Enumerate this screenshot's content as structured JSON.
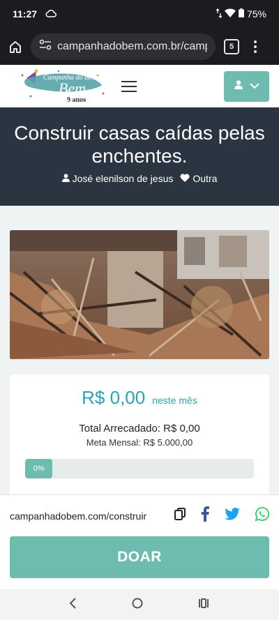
{
  "status_bar": {
    "time": "11:27",
    "battery": "75%"
  },
  "browser": {
    "url": "campanhadobem.com.br/campanh",
    "tab_count": "5"
  },
  "site": {
    "logo_text": "Campanha do Bem",
    "logo_sub": "9 anos"
  },
  "campaign": {
    "title": "Construir casas caídas pelas enchentes.",
    "author": "José elenilson de jesus",
    "category": "Outra",
    "amount": "R$ 0,00",
    "amount_period": "neste mês",
    "total_raised": "Total Arrecadado: R$ 0,00",
    "monthly_goal": "Meta Mensal: R$ 5.000,00",
    "progress_label": "0%",
    "progress_value": 0
  },
  "share": {
    "url": "campanhadobem.com/construir"
  },
  "donate": {
    "label": "DOAR"
  },
  "colors": {
    "accent": "#6dbcaf",
    "amount": "#28a4b6",
    "hero_bg": "#2b3541",
    "facebook": "#3b5998",
    "twitter": "#1da1f2",
    "whatsapp": "#25d366"
  }
}
